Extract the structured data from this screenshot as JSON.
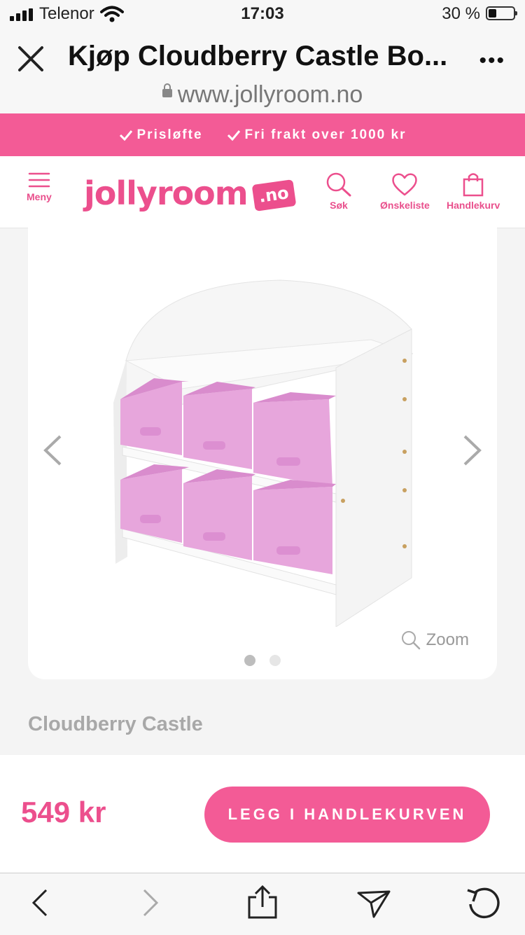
{
  "status": {
    "carrier": "Telenor",
    "time": "17:03",
    "battery": "30 %"
  },
  "browser": {
    "title": "Kjøp Cloudberry Castle Bo...",
    "url": "www.jollyroom.no"
  },
  "promo": {
    "items": [
      "Prisløfte",
      "Fri frakt over 1000 kr"
    ]
  },
  "header": {
    "menu_label": "Meny",
    "logo_text": "jollyroom",
    "logo_tld": ".no",
    "search_label": "Søk",
    "wishlist_label": "Ønskeliste",
    "cart_label": "Handlekurv"
  },
  "gallery": {
    "zoom_label": "Zoom",
    "active_index": 0,
    "image_count": 2
  },
  "product": {
    "brand": "Cloudberry Castle",
    "price": "549 kr",
    "add_to_cart": "LEGG I HANDLEKURVEN"
  },
  "colors": {
    "accent": "#f35b96",
    "accent_text": "#ec4f8d",
    "bin_pink": "#e7a6dc",
    "bin_dark": "#d98ccd"
  }
}
